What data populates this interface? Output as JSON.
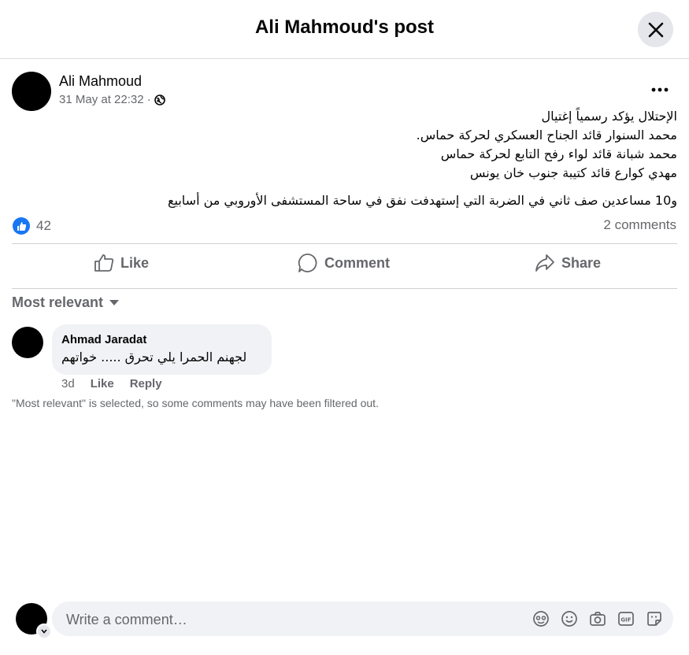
{
  "header": {
    "title": "Ali Mahmoud's post",
    "close_icon": "close-icon"
  },
  "post": {
    "author": "Ali Mahmoud",
    "timestamp": "31 May at 22:32",
    "separator": "·",
    "privacy_icon": "globe-icon",
    "more_icon": "more-icon",
    "lines": [
      "الإحتلال يؤكد رسمياً إغتيال",
      "محمد السنوار  قائد الجناح العسكري لحركة حماس.",
      "محمد شبانة قائد لواء رفح التابع لحركة حماس",
      " مهدي كوارع قائد كتيبة جنوب خان يونس",
      "و10 مساعدين صف ثاني في الضربة التي إستهدفت نفق في ساحة المستشفى الأوروبي من أسابيع"
    ],
    "reaction_count": "42",
    "comments_count": "2 comments"
  },
  "actions": {
    "like": "Like",
    "comment": "Comment",
    "share": "Share"
  },
  "sort": {
    "label": "Most relevant"
  },
  "comments": [
    {
      "author": "Ahmad Jaradat",
      "text": "لجهنم الحمرا يلي تحرق ..... خواتهم",
      "age": "3d",
      "like": "Like",
      "reply": "Reply"
    }
  ],
  "filter_note": "\"Most relevant\" is selected, so some comments may have been filtered out.",
  "compose": {
    "placeholder": "Write a comment…",
    "tools": [
      "avatar-sticker-icon",
      "emoji-icon",
      "camera-icon",
      "gif-icon",
      "sticker-icon"
    ]
  },
  "colors": {
    "accent": "#1877f2",
    "muted": "#65676b",
    "bubble": "#f0f2f5"
  }
}
